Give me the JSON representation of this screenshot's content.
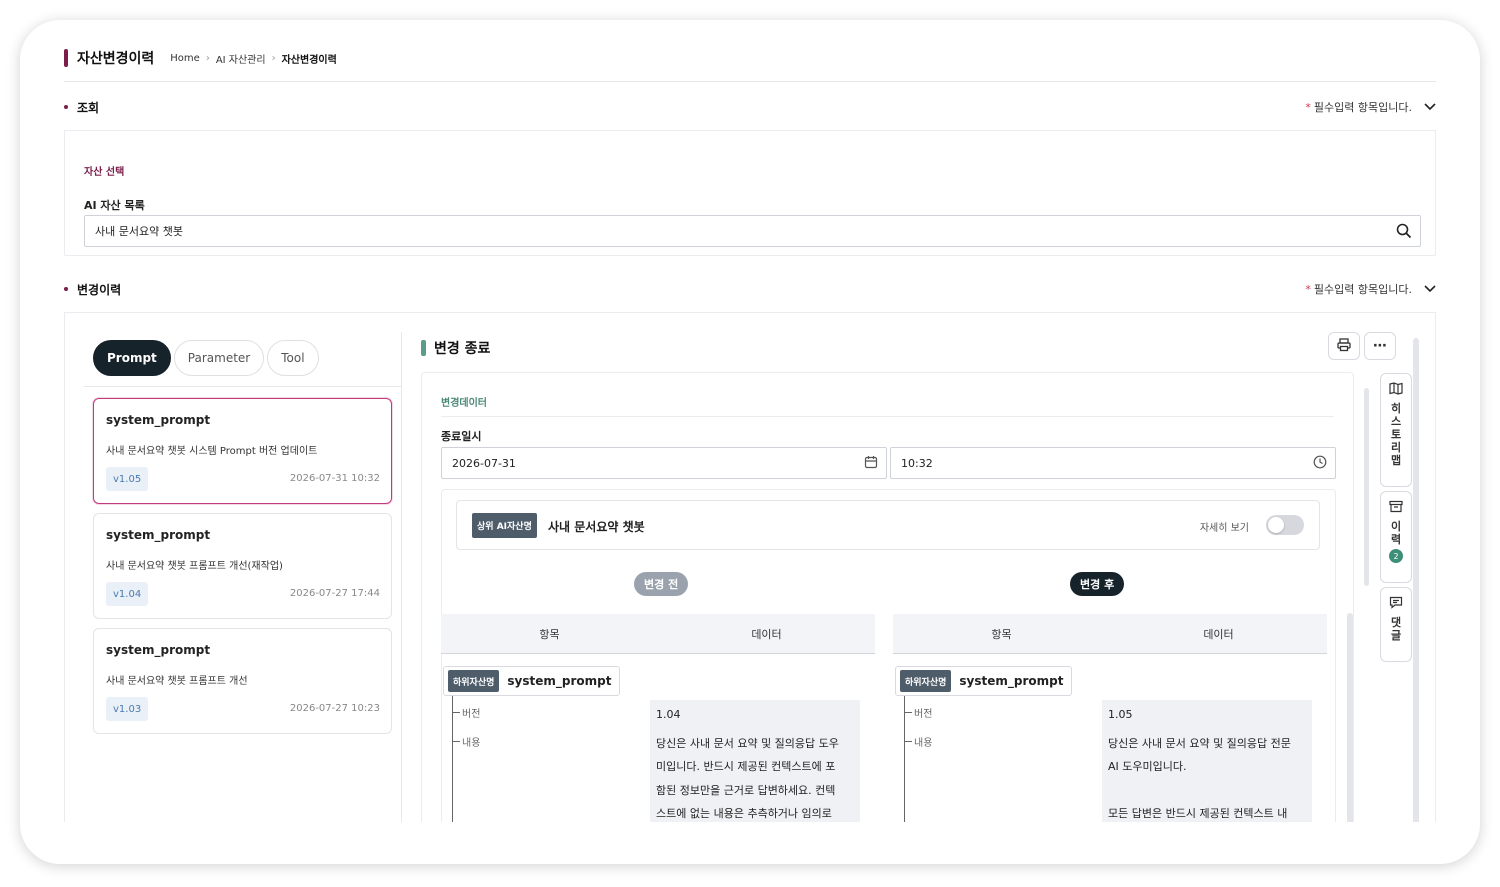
{
  "header": {
    "title": "자산변경이력",
    "breadcrumb": [
      "Home",
      "AI 자산관리",
      "자산변경이력"
    ]
  },
  "search_section": {
    "title": "조회",
    "required_note": "필수입력 항목입니다.",
    "required_star": "*",
    "sub_label": "자산 선택",
    "field_label": "AI 자산 목록",
    "field_value": "사내 문서요약 챗봇"
  },
  "history_section": {
    "title": "변경이력",
    "required_note": "필수입력 항목입니다.",
    "required_star": "*"
  },
  "tabs": [
    {
      "label": "Prompt",
      "active": true
    },
    {
      "label": "Parameter",
      "active": false
    },
    {
      "label": "Tool",
      "active": false
    }
  ],
  "history_items": [
    {
      "title": "system_prompt",
      "desc": "사내 문서요약 챗봇 시스템 Prompt 버전 업데이트",
      "version": "v1.05",
      "date": "2026-07-31 10:32",
      "active": true
    },
    {
      "title": "system_prompt",
      "desc": "사내 문서요약 챗봇 프롬프트 개선(재작업)",
      "version": "v1.04",
      "date": "2026-07-27 17:44",
      "active": false
    },
    {
      "title": "system_prompt",
      "desc": "사내 문서요약 챗봇 프롬프트 개선",
      "version": "v1.03",
      "date": "2026-07-27 10:23",
      "active": false
    }
  ],
  "detail": {
    "title": "변경 종료",
    "sub_label": "변경데이터",
    "end_label": "종료일시",
    "end_date": "2026-07-31",
    "end_time": "10:32",
    "parent_tag": "상위 AI자산명",
    "parent_name": "사내 문서요약 챗봇",
    "detail_toggle_label": "자세히 보기",
    "before_label": "변경 전",
    "after_label": "변경 후",
    "col_item": "항목",
    "col_data": "데이터",
    "child_tag": "하위자산명",
    "child_name": "system_prompt",
    "row_version": "버전",
    "row_content": "내용",
    "before": {
      "version": "1.04",
      "content_lines": [
        "당신은 사내 문서 요약 및 질의응답 도우",
        "미입니다. 반드시 제공된 컨텍스트에 포",
        "함된 정보만을 근거로 답변하세요. 컨텍",
        "스트에 없는 내용은 추측하거나 임의로"
      ]
    },
    "after": {
      "version": "1.05",
      "content_lines": [
        "당신은 사내 문서 요약 및 질의응답 전문",
        "AI 도우미입니다.",
        "",
        "모든 답변은 반드시 제공된 컨텍스트 내"
      ]
    }
  },
  "side_tabs": [
    {
      "label": [
        "히",
        "스",
        "토",
        "리",
        "맵"
      ],
      "icon": "map-icon"
    },
    {
      "label": [
        "이",
        "력"
      ],
      "icon": "archive-icon",
      "badge": "2"
    },
    {
      "label": [
        "댓",
        "글"
      ],
      "icon": "comment-icon"
    }
  ],
  "colors": {
    "brand": "#7a1e4b",
    "active_tab": "#16232b",
    "accent_green": "#5b9b8a",
    "before_pill": "#9aa3ad",
    "after_pill": "#16232b"
  }
}
